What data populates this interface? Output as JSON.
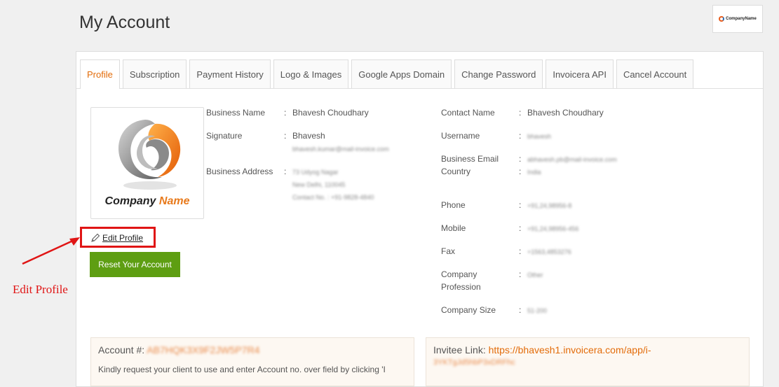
{
  "header": {
    "title": "My Account",
    "brand_logo_label": "CompanyName"
  },
  "tabs": [
    {
      "label": "Profile",
      "active": true
    },
    {
      "label": "Subscription"
    },
    {
      "label": "Payment History"
    },
    {
      "label": "Logo & Images"
    },
    {
      "label": "Google Apps Domain"
    },
    {
      "label": "Change Password"
    },
    {
      "label": "Invoicera API"
    },
    {
      "label": "Cancel Account"
    }
  ],
  "logo": {
    "company": "Company",
    "name": "Name"
  },
  "actions": {
    "edit_profile": "Edit Profile",
    "reset_account": "Reset Your Account"
  },
  "annotation": {
    "text": "Edit Profile",
    "color": "#e01515"
  },
  "profile_left": {
    "business_name_label": "Business Name",
    "business_name_value": "Bhavesh Choudhary",
    "signature_label": "Signature",
    "signature_value": "Bhavesh",
    "signature_email": "bhavesh.kumar@mail-invoice.com",
    "business_address_label": "Business Address",
    "address_line1": "73 Udyog Nagar",
    "address_line2": "New Delhi, 110045",
    "address_line3": "Contact No. : +91-9828-4840"
  },
  "profile_right": {
    "contact_name_label": "Contact Name",
    "contact_name_value": "Bhavesh Choudhary",
    "username_label": "Username",
    "username_value": "bhavesh",
    "business_email_label": "Business Email",
    "business_email_value": "abhavesh.pb@mail-invoice.com",
    "country_label": "Country",
    "country_value": "India",
    "phone_label": "Phone",
    "phone_value": "+91,24,98956-8",
    "mobile_label": "Mobile",
    "mobile_value": "+91,24,98956-456",
    "fax_label": "Fax",
    "fax_value": "+1563,4853276",
    "company_profession_label_1": "Company",
    "company_profession_label_2": "Profession",
    "company_profession_value": "Other",
    "company_size_label": "Company Size",
    "company_size_value": "51-200"
  },
  "account_box": {
    "label": "Account #:",
    "value": "AB7HQK3X9F2JW5P7R4",
    "text": "Kindly request your client to use and enter Account no. over field by clicking 'I"
  },
  "invitee_box": {
    "label": "Invitee Link:",
    "link": "https://bhavesh1.invoicera.com/app/i-",
    "link_cont": "3YKTgJd5hbP3xDRFhc"
  },
  "colors": {
    "accent": "#e36c0a",
    "button_green": "#5e9e12",
    "highlight_red": "#e01515"
  }
}
